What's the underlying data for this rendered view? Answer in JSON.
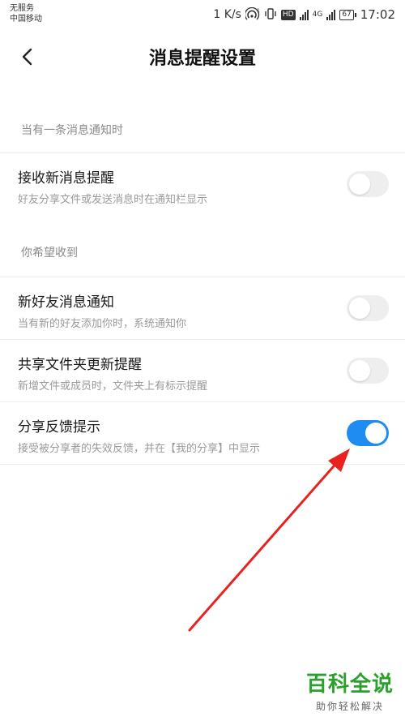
{
  "status_bar": {
    "carrier_line1": "无服务",
    "carrier_line2": "中国移动",
    "net_speed": "1 K/s",
    "hd_label": "HD",
    "net_type": "4G",
    "battery_level": "67",
    "time": "17:02"
  },
  "header": {
    "title": "消息提醒设置"
  },
  "sections": [
    {
      "header": "当有一条消息通知时",
      "items": [
        {
          "title": "接收新消息提醒",
          "description": "好友分享文件或发送消息时在通知栏显示",
          "enabled": false
        }
      ]
    },
    {
      "header": "你希望收到",
      "items": [
        {
          "title": "新好友消息通知",
          "description": "当有新的好友添加你时，系统通知你",
          "enabled": false
        },
        {
          "title": "共享文件夹更新提醒",
          "description": "新增文件或成员时，文件夹上有标示提醒",
          "enabled": false
        },
        {
          "title": "分享反馈提示",
          "description": "接受被分享者的失效反馈，并在【我的分享】中显示",
          "enabled": true
        }
      ]
    }
  ],
  "colors": {
    "toggle_on": "#1e8cf0",
    "toggle_off": "#eeeeee",
    "annotation_arrow": "#e8231f",
    "watermark": "#2aa12c"
  },
  "watermark": {
    "title": "百科全说",
    "subtitle": "助你轻松解决"
  }
}
